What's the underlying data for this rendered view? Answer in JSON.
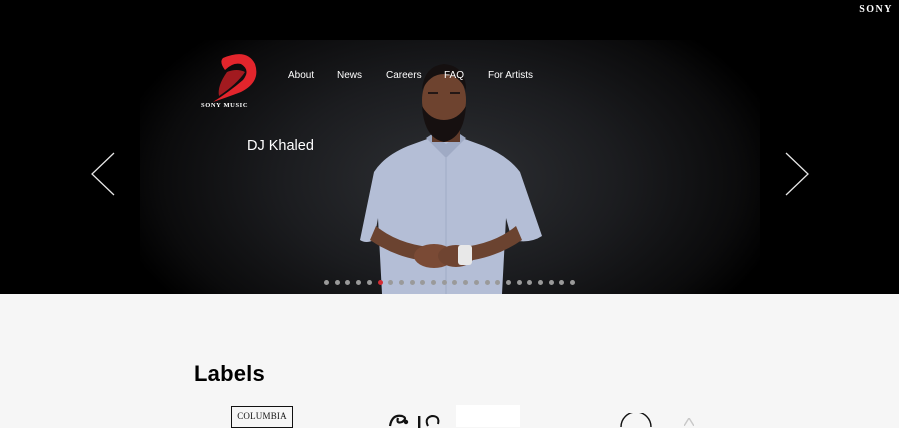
{
  "header": {
    "sony_logo": "SONY"
  },
  "brand": {
    "name": "SONY MUSIC"
  },
  "nav": {
    "items": [
      "About",
      "News",
      "Careers",
      "FAQ",
      "For Artists"
    ]
  },
  "hero": {
    "artist_name": "DJ Khaled",
    "slide_count": 24,
    "active_slide_index": 5
  },
  "labels_section": {
    "title": "Labels",
    "logos": [
      {
        "name": "COLUMBIA"
      },
      {
        "name": "epic-logo-partial"
      },
      {
        "name": "blank-label-card"
      },
      {
        "name": "circle-logo-partial"
      }
    ]
  },
  "colors": {
    "accent_red": "#d32b33",
    "page_bg": "#f6f6f6",
    "hero_bg": "#000000",
    "shirt": "#b4bed6"
  }
}
